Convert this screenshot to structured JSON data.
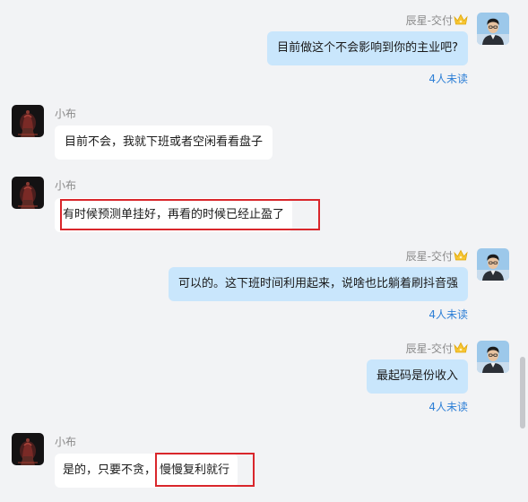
{
  "messages": [
    {
      "sender": "辰星-交付",
      "text": "目前做这个不会影响到你的主业吧?",
      "status": "4人未读"
    },
    {
      "sender": "小布",
      "text": "目前不会，我就下班或者空闲看看盘子"
    },
    {
      "sender": "小布",
      "text": "有时候预测单挂好，再看的时候已经止盈了"
    },
    {
      "sender": "辰星-交付",
      "text": "可以的。这下班时间利用起来，说啥也比躺着刷抖音强",
      "status": "4人未读"
    },
    {
      "sender": "辰星-交付",
      "text": "最起码是份收入",
      "status": "4人未读"
    },
    {
      "sender": "小布",
      "text_part1": "是的，只要不贪，",
      "text_part2": "慢慢复利就行"
    }
  ],
  "colors": {
    "background": "#f2f3f5",
    "own_bubble": "#c9e6fc",
    "other_bubble": "#ffffff",
    "unread_status": "#2d7fd6",
    "highlight_box": "#d9262b"
  }
}
